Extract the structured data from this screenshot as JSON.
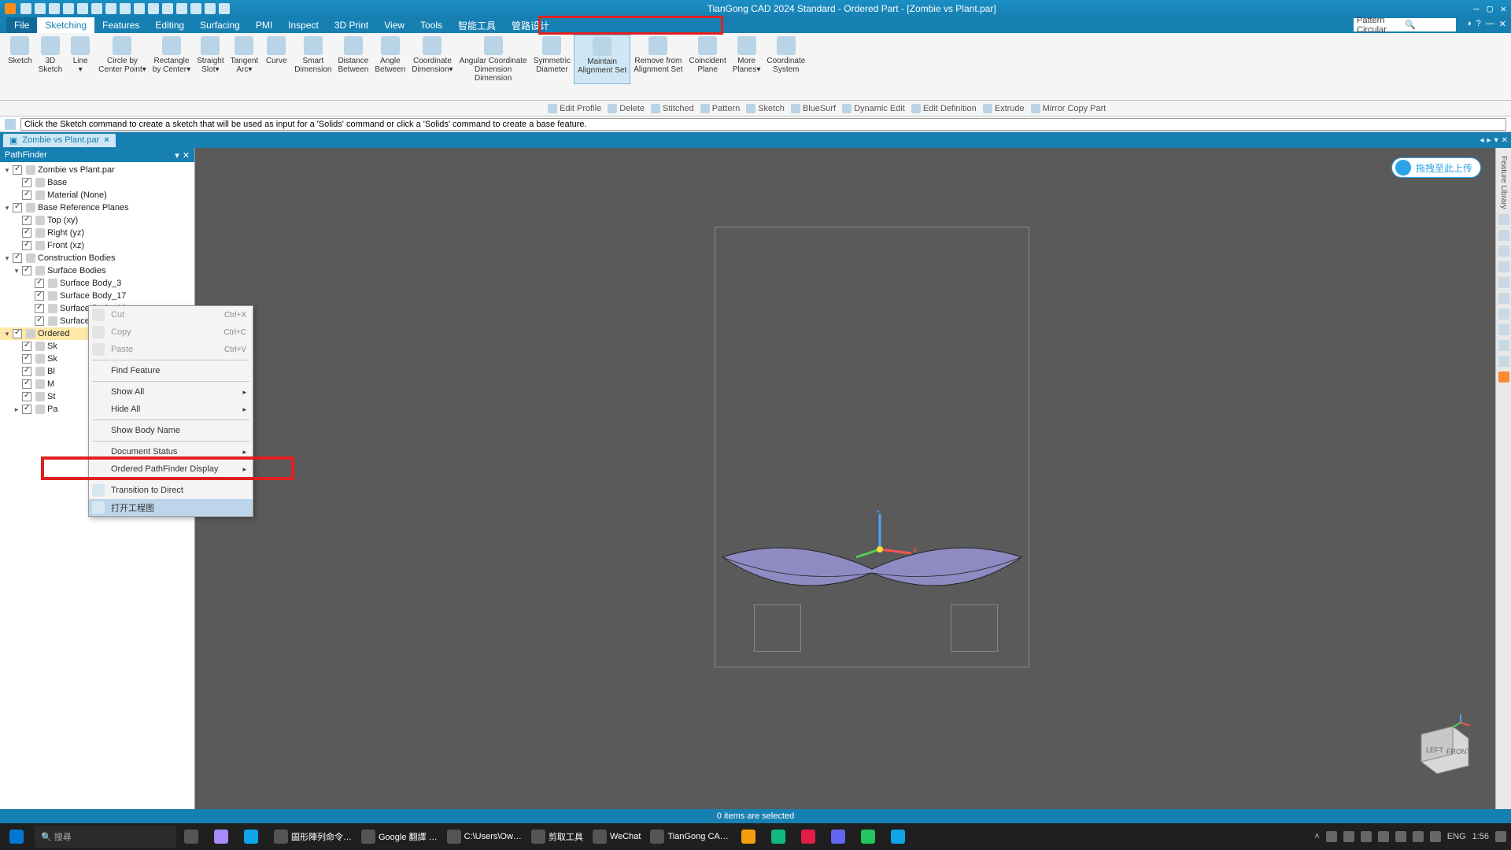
{
  "app": {
    "title": "TianGong CAD 2024 Standard - Ordered Part - [Zombie vs Plant.par]"
  },
  "menu": {
    "file": "File",
    "tabs": [
      "Sketching",
      "Features",
      "Editing",
      "Surfacing",
      "PMI",
      "Inspect",
      "3D Print",
      "View",
      "Tools",
      "智能工具",
      "管路设计"
    ],
    "active": 0,
    "searchPlaceholder": "Pattern Circular"
  },
  "ribbon": {
    "buttons": [
      {
        "label": "Sketch"
      },
      {
        "label": "3D\nSketch"
      },
      {
        "label": "Line\n▾"
      },
      {
        "label": "Circle by\nCenter Point▾"
      },
      {
        "label": "Rectangle\nby Center▾"
      },
      {
        "label": "Straight\nSlot▾"
      },
      {
        "label": "Tangent\nArc▾"
      },
      {
        "label": "Curve"
      },
      {
        "label": "Smart\nDimension"
      },
      {
        "label": "Distance\nBetween"
      },
      {
        "label": "Angle\nBetween"
      },
      {
        "label": "Coordinate\nDimension▾"
      },
      {
        "label": "Angular Coordinate\nDimension\nDimension"
      },
      {
        "label": "Symmetric\nDiameter"
      },
      {
        "label": "Maintain\nAlignment Set",
        "sel": true
      },
      {
        "label": "Remove from\nAlignment Set"
      },
      {
        "label": "Coincident\nPlane"
      },
      {
        "label": "More\nPlanes▾"
      },
      {
        "label": "Coordinate\nSystem"
      }
    ]
  },
  "subbar": [
    "Edit Profile",
    "Delete",
    "Stitched",
    "Pattern",
    "Sketch",
    "BlueSurf",
    "Dynamic Edit",
    "Edit Definition",
    "Extrude",
    "Mirror Copy Part"
  ],
  "prompt": "Click the Sketch command to create a sketch that will be used as input for a 'Solids' command or click a 'Solids' command to create a base feature.",
  "doc": {
    "tab": "Zombie vs Plant.par"
  },
  "pathfinder": {
    "title": "PathFinder",
    "nodes": [
      {
        "lvl": 0,
        "exp": "▾",
        "label": "Zombie vs Plant.par"
      },
      {
        "lvl": 1,
        "exp": " ",
        "label": "Base"
      },
      {
        "lvl": 1,
        "exp": " ",
        "label": "Material (None)"
      },
      {
        "lvl": 0,
        "exp": "▾",
        "label": "Base Reference Planes"
      },
      {
        "lvl": 1,
        "exp": " ",
        "label": "Top (xy)"
      },
      {
        "lvl": 1,
        "exp": " ",
        "label": "Right (yz)"
      },
      {
        "lvl": 1,
        "exp": " ",
        "label": "Front (xz)"
      },
      {
        "lvl": 0,
        "exp": "▾",
        "label": "Construction Bodies"
      },
      {
        "lvl": 1,
        "exp": "▾",
        "label": "Surface Bodies"
      },
      {
        "lvl": 2,
        "exp": " ",
        "label": "Surface Body_3"
      },
      {
        "lvl": 2,
        "exp": " ",
        "label": "Surface Body_17"
      },
      {
        "lvl": 2,
        "exp": " ",
        "label": "Surface Body_18"
      },
      {
        "lvl": 2,
        "exp": " ",
        "label": "Surface Body_19"
      },
      {
        "lvl": 0,
        "exp": "▾",
        "label": "Ordered",
        "sel": true
      },
      {
        "lvl": 1,
        "exp": " ",
        "label": "Sk"
      },
      {
        "lvl": 1,
        "exp": " ",
        "label": "Sk"
      },
      {
        "lvl": 1,
        "exp": " ",
        "label": "Bl"
      },
      {
        "lvl": 1,
        "exp": " ",
        "label": "M"
      },
      {
        "lvl": 1,
        "exp": " ",
        "label": "St"
      },
      {
        "lvl": 1,
        "exp": "▸",
        "label": "Pa"
      }
    ]
  },
  "context": {
    "items": [
      {
        "label": "Cut",
        "shortcut": "Ctrl+X",
        "dis": true,
        "icon": true
      },
      {
        "label": "Copy",
        "shortcut": "Ctrl+C",
        "dis": true,
        "icon": true
      },
      {
        "label": "Paste",
        "shortcut": "Ctrl+V",
        "dis": true,
        "icon": true
      },
      {
        "sep": true
      },
      {
        "label": "Find Feature"
      },
      {
        "sep": true
      },
      {
        "label": "Show All",
        "sub": true
      },
      {
        "label": "Hide All",
        "sub": true
      },
      {
        "sep": true
      },
      {
        "label": "Show Body Name"
      },
      {
        "sep": true
      },
      {
        "label": "Document Status",
        "sub": true
      },
      {
        "label": "Ordered PathFinder Display",
        "sub": true
      },
      {
        "sep": true
      },
      {
        "label": "Transition to Direct",
        "icon": true
      },
      {
        "label": "打开工程图",
        "hl": true,
        "icon": true
      }
    ]
  },
  "viewport": {
    "uploadLabel": "拖拽至此上传",
    "cubeLeft": "LEFT",
    "cubeFront": "FRONT"
  },
  "status": "0 items are selected",
  "taskbar": {
    "search": "搜尋",
    "apps": [
      "圖形陣列命令…",
      "Google 翻譯 …",
      "C:\\Users\\Ow…",
      "剪取工具",
      "WeChat",
      "TianGong CA…"
    ],
    "lang": "ENG",
    "time": "1:56"
  }
}
